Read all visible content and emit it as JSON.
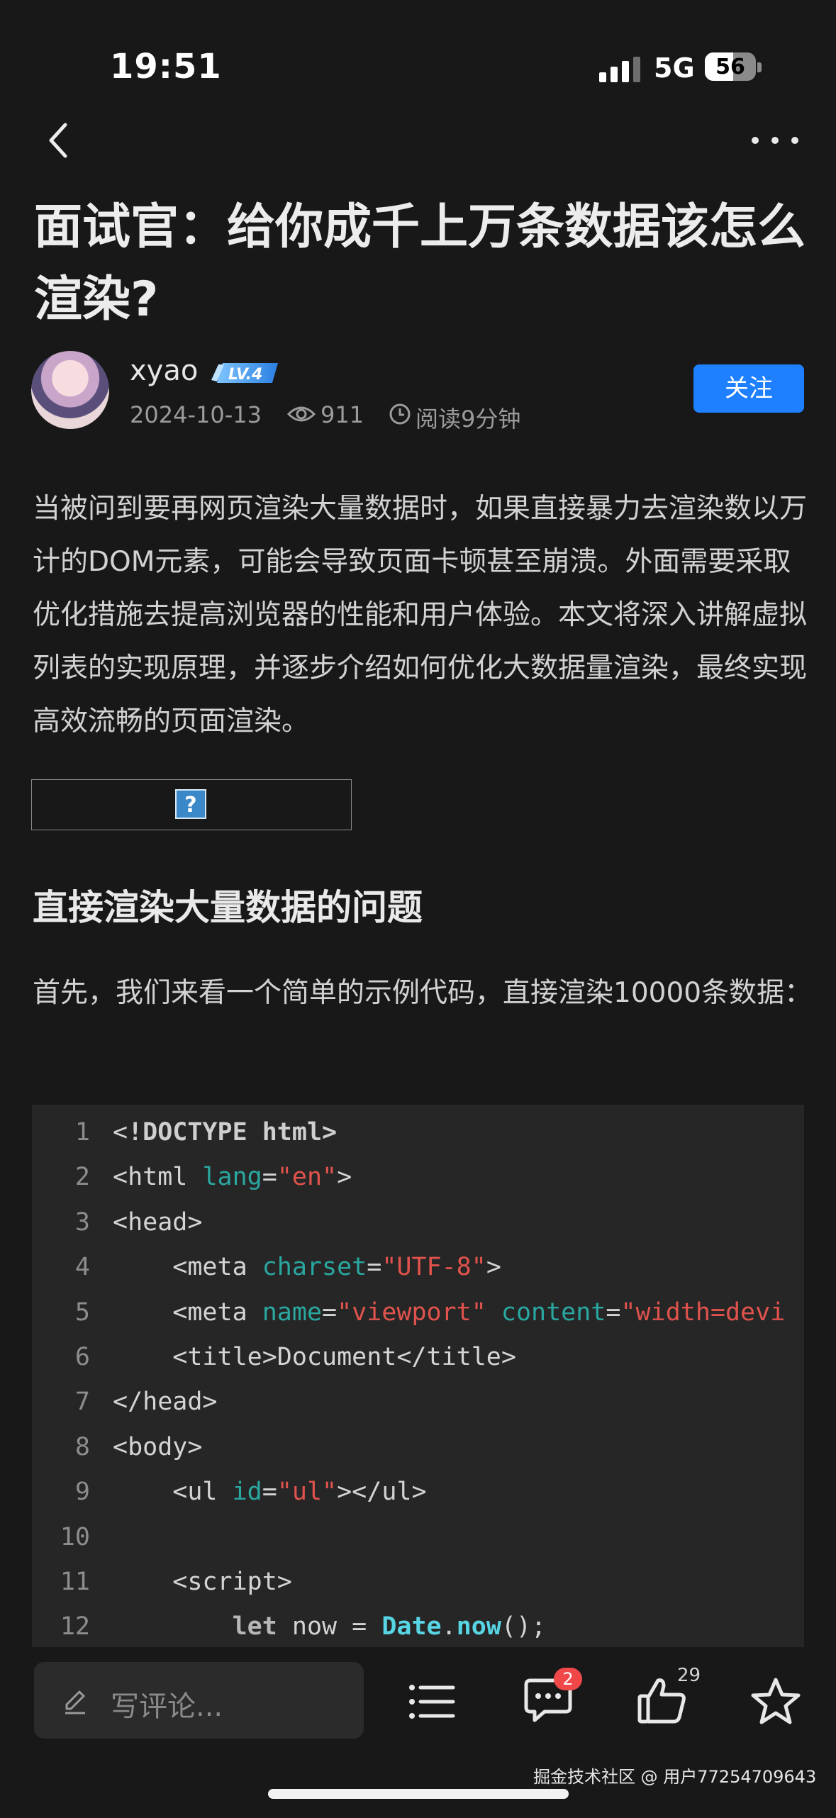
{
  "status_bar": {
    "time": "19:51",
    "network": "5G",
    "battery": "56",
    "battery_level": 0.56
  },
  "article": {
    "title": "面试官：给你成千上万条数据该怎么渲染?",
    "author": {
      "name": "xyao",
      "level": "LV.4"
    },
    "date": "2024-10-13",
    "views": "911",
    "read_time": "阅读9分钟",
    "follow_label": "关注",
    "intro": "当被问到要再网页渲染大量数据时，如果直接暴力去渲染数以万计的DOM元素，可能会导致页面卡顿甚至崩溃。外面需要采取优化措施去提高浏览器的性能和用户体验。本文将深入讲解虚拟列表的实现原理，并逐步介绍如何优化大数据量渲染，最终实现高效流畅的页面渲染。",
    "image_placeholder": "?",
    "heading": "直接渲染大量数据的问题",
    "paragraph": "首先，我们来看一个简单的示例代码，直接渲染10000条数据："
  },
  "code": {
    "lines": [
      {
        "n": "1",
        "tokens": [
          {
            "t": "<",
            "c": "tag"
          },
          {
            "t": "!DOCTYPE",
            "c": "bold"
          },
          {
            "t": " html>",
            "c": "bold"
          }
        ]
      },
      {
        "n": "2",
        "tokens": [
          {
            "t": "<html ",
            "c": "tag"
          },
          {
            "t": "lang",
            "c": "attr"
          },
          {
            "t": "=",
            "c": "tag"
          },
          {
            "t": "\"en\"",
            "c": "str"
          },
          {
            "t": ">",
            "c": "tag"
          }
        ]
      },
      {
        "n": "3",
        "tokens": [
          {
            "t": "<head>",
            "c": "tag"
          }
        ]
      },
      {
        "n": "4",
        "tokens": [
          {
            "t": "    <meta ",
            "c": "tag"
          },
          {
            "t": "charset",
            "c": "attr"
          },
          {
            "t": "=",
            "c": "tag"
          },
          {
            "t": "\"UTF-8\"",
            "c": "str"
          },
          {
            "t": ">",
            "c": "tag"
          }
        ]
      },
      {
        "n": "5",
        "tokens": [
          {
            "t": "    <meta ",
            "c": "tag"
          },
          {
            "t": "name",
            "c": "attr"
          },
          {
            "t": "=",
            "c": "tag"
          },
          {
            "t": "\"viewport\"",
            "c": "str"
          },
          {
            "t": " ",
            "c": "tag"
          },
          {
            "t": "content",
            "c": "attr"
          },
          {
            "t": "=",
            "c": "tag"
          },
          {
            "t": "\"width=devi",
            "c": "str"
          }
        ]
      },
      {
        "n": "6",
        "tokens": [
          {
            "t": "    <title>Document</title>",
            "c": "tag"
          }
        ]
      },
      {
        "n": "7",
        "tokens": [
          {
            "t": "</head>",
            "c": "tag"
          }
        ]
      },
      {
        "n": "8",
        "tokens": [
          {
            "t": "<body>",
            "c": "tag"
          }
        ]
      },
      {
        "n": "9",
        "tokens": [
          {
            "t": "    <ul ",
            "c": "tag"
          },
          {
            "t": "id",
            "c": "attr"
          },
          {
            "t": "=",
            "c": "tag"
          },
          {
            "t": "\"ul\"",
            "c": "str"
          },
          {
            "t": "></ul>",
            "c": "tag"
          }
        ]
      },
      {
        "n": "10",
        "tokens": []
      },
      {
        "n": "11",
        "tokens": [
          {
            "t": "    <script>",
            "c": "tag"
          }
        ]
      },
      {
        "n": "12",
        "tokens": [
          {
            "t": "        ",
            "c": "tag"
          },
          {
            "t": "let",
            "c": "kw"
          },
          {
            "t": " now = ",
            "c": "tag"
          },
          {
            "t": "Date",
            "c": "fn"
          },
          {
            "t": ".",
            "c": "tag"
          },
          {
            "t": "now",
            "c": "fn"
          },
          {
            "t": "();",
            "c": "tag"
          }
        ]
      }
    ]
  },
  "bottom_bar": {
    "comment_placeholder": "写评论...",
    "comment_count": "2",
    "like_count": "29"
  },
  "watermark": "掘金技术社区 @ 用户77254709643"
}
